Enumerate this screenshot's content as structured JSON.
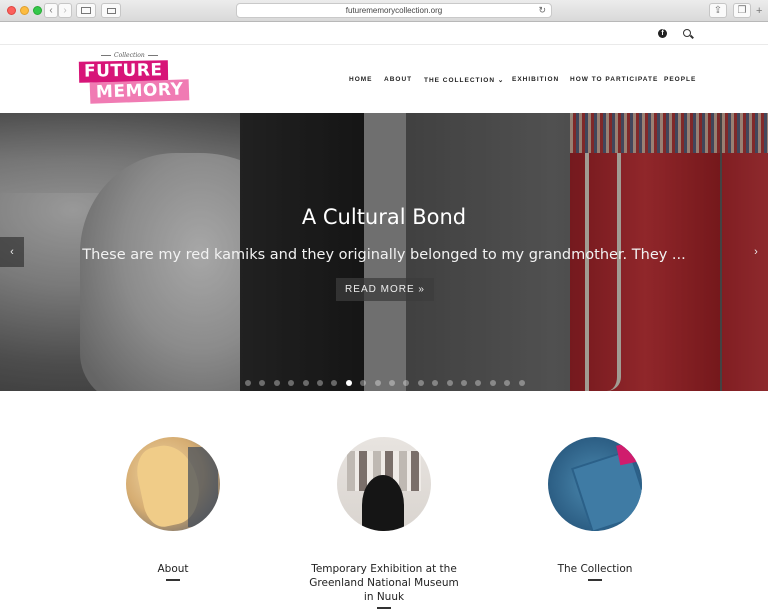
{
  "browser": {
    "url": "futurememorycollection.org",
    "back_glyph": "‹",
    "forward_glyph": "›",
    "plus_glyph": "+"
  },
  "topbar": {
    "facebook_glyph": "f",
    "icons": [
      "facebook-icon",
      "search-icon"
    ]
  },
  "logo": {
    "small": "Collection",
    "line1": "FUTURE",
    "line2": "MEMORY",
    "colors": {
      "future_bg": "#d71578",
      "memory_bg": "#f07bb3"
    }
  },
  "nav": {
    "items": [
      {
        "label": "HOME"
      },
      {
        "label": "ABOUT"
      },
      {
        "label": "THE COLLECTION ⌄"
      },
      {
        "label": "EXHIBITION"
      },
      {
        "label": "HOW TO PARTICIPATE"
      },
      {
        "label": "PEOPLE"
      }
    ]
  },
  "hero": {
    "title": "A Cultural Bond",
    "excerpt": "These are my red kamiks and they originally belonged to my grandmother. They ...",
    "button": "READ MORE »",
    "prev_glyph": "‹",
    "next_glyph": "›",
    "slide_count": 20,
    "active_slide": 7
  },
  "features": [
    {
      "title": "About"
    },
    {
      "title": "Temporary Exhibition at the Greenland National Museum in Nuuk"
    },
    {
      "title": "The Collection"
    }
  ]
}
